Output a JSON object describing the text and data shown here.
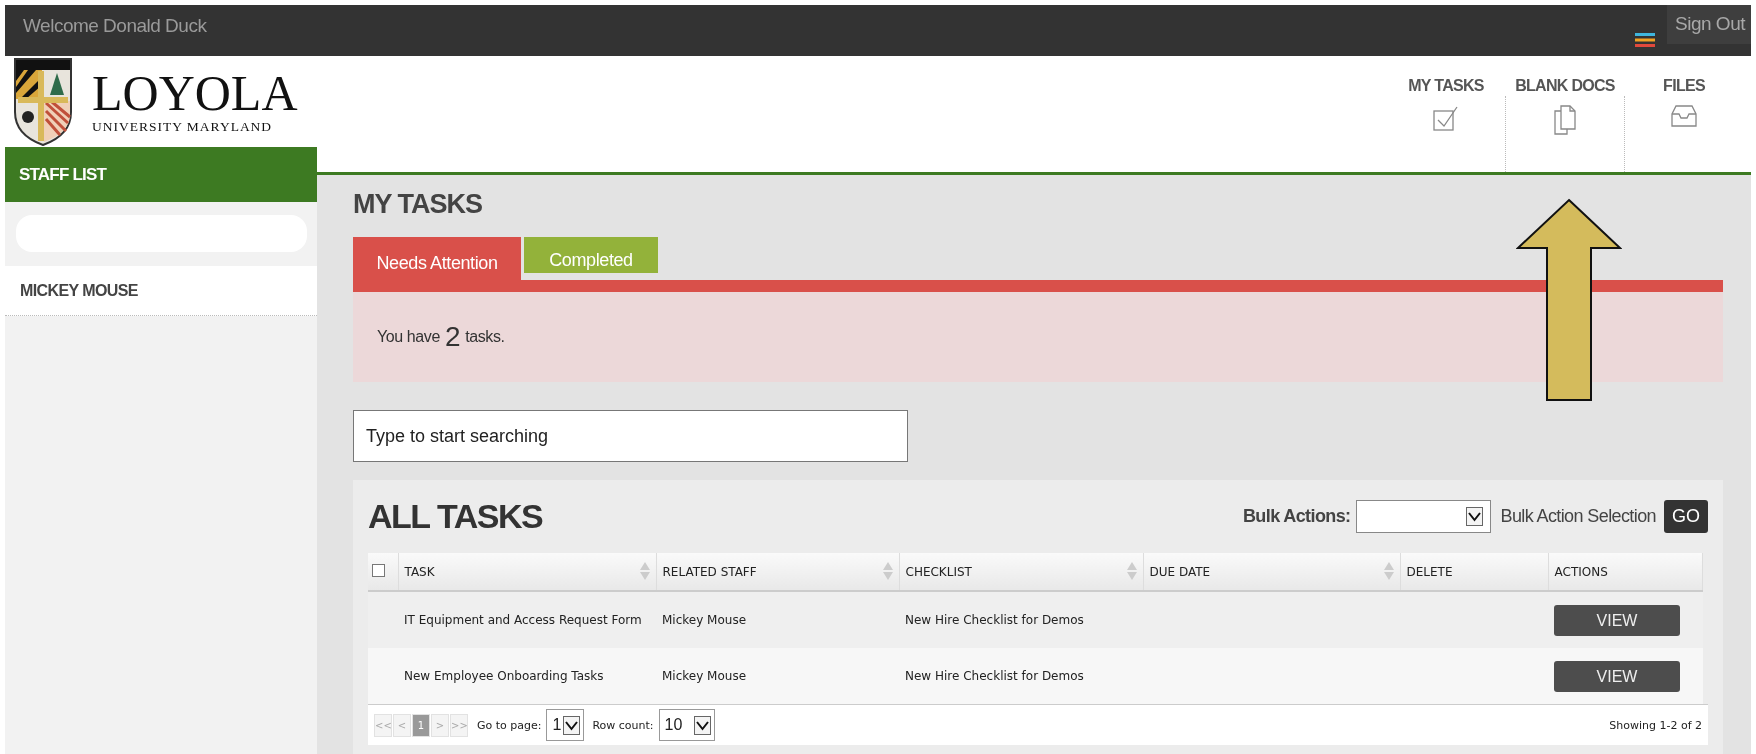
{
  "top_bar": {
    "welcome": "Welcome Donald Duck",
    "sign_out": "Sign Out"
  },
  "logo": {
    "name": "LOYOLA",
    "subtitle": "UNIVERSITY MARYLAND"
  },
  "nav": [
    {
      "label": "MY TASKS",
      "kind": "check"
    },
    {
      "label": "BLANK DOCS",
      "kind": "docs"
    },
    {
      "label": "FILES",
      "kind": "tray"
    }
  ],
  "sidebar": {
    "title": "STAFF LIST",
    "items": [
      {
        "label": "MICKEY MOUSE"
      }
    ]
  },
  "page_title": "MY TASKS",
  "tabs": [
    {
      "label": "Needs Attention",
      "selected": true,
      "color": "#d9504a"
    },
    {
      "label": "Completed",
      "selected": false,
      "color": "#93b23a"
    }
  ],
  "notice": {
    "prefix": "You have",
    "count": "2",
    "suffix": "tasks."
  },
  "search": {
    "placeholder": "Type to start searching"
  },
  "all_tasks": {
    "title": "ALL TASKS",
    "bulk_label": "Bulk Actions:",
    "bulk_selection": "Bulk Action Selection",
    "go": "GO"
  },
  "table": {
    "select_all_checked": false,
    "columns": [
      {
        "label": "TASK",
        "sortable": true
      },
      {
        "label": "RELATED STAFF",
        "sortable": true
      },
      {
        "label": "CHECKLIST",
        "sortable": true
      },
      {
        "label": "DUE DATE",
        "sortable": true
      },
      {
        "label": "DELETE",
        "sortable": false
      },
      {
        "label": "ACTIONS",
        "sortable": false
      }
    ],
    "rows": [
      {
        "task": "IT Equipment and Access Request Form",
        "related_staff": "Mickey Mouse",
        "checklist": "New Hire Checklist for Demos",
        "action": "VIEW"
      },
      {
        "task": "New Employee Onboarding Tasks",
        "related_staff": "Mickey Mouse",
        "checklist": "New Hire Checklist for Demos",
        "action": "VIEW"
      }
    ]
  },
  "pagination": {
    "first": "<<",
    "prev": "<",
    "pages": [
      {
        "label": "1",
        "selected": true
      }
    ],
    "next": ">",
    "last": ">>",
    "go_to_label": "Go to page:",
    "page_value": "1",
    "row_count_label": "Row count:",
    "row_count_value": "10",
    "summary": "Showing 1-2 of 2"
  }
}
